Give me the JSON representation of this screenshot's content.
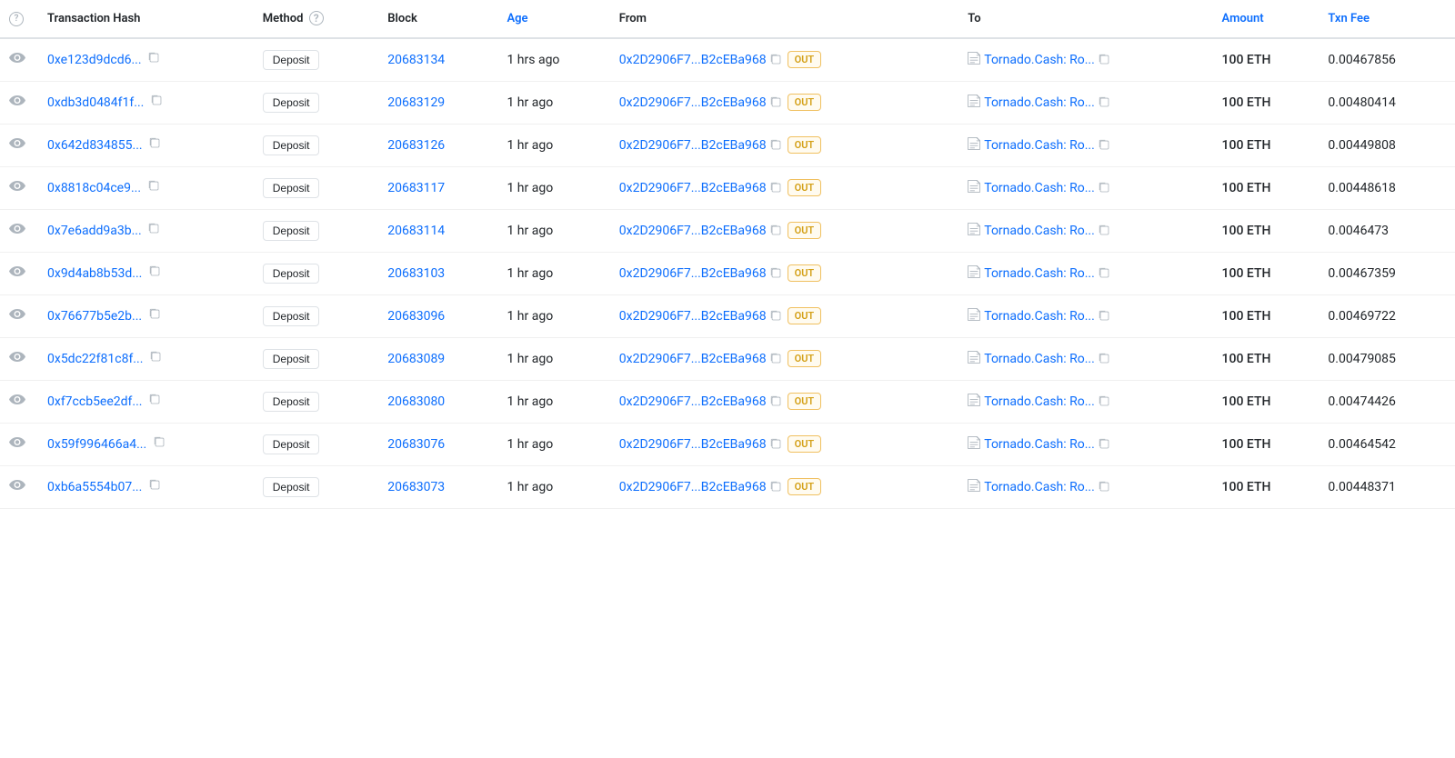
{
  "header": {
    "col_info": "ⓘ",
    "col_tx_hash": "Transaction Hash",
    "col_method": "Method",
    "col_method_help": "?",
    "col_block": "Block",
    "col_age": "Age",
    "col_from": "From",
    "col_to": "To",
    "col_amount": "Amount",
    "col_txn_fee": "Txn Fee"
  },
  "rows": [
    {
      "tx_hash": "0xe123d9dcd6...",
      "method": "Deposit",
      "block": "20683134",
      "age": "1 hrs ago",
      "from": "0x2D2906F7...B2cEBa968",
      "direction": "OUT",
      "to": "Tornado.Cash: Ro...",
      "amount": "100 ETH",
      "txn_fee": "0.00467856"
    },
    {
      "tx_hash": "0xdb3d0484f1f...",
      "method": "Deposit",
      "block": "20683129",
      "age": "1 hr ago",
      "from": "0x2D2906F7...B2cEBa968",
      "direction": "OUT",
      "to": "Tornado.Cash: Ro...",
      "amount": "100 ETH",
      "txn_fee": "0.00480414"
    },
    {
      "tx_hash": "0x642d834855...",
      "method": "Deposit",
      "block": "20683126",
      "age": "1 hr ago",
      "from": "0x2D2906F7...B2cEBa968",
      "direction": "OUT",
      "to": "Tornado.Cash: Ro...",
      "amount": "100 ETH",
      "txn_fee": "0.00449808"
    },
    {
      "tx_hash": "0x8818c04ce9...",
      "method": "Deposit",
      "block": "20683117",
      "age": "1 hr ago",
      "from": "0x2D2906F7...B2cEBa968",
      "direction": "OUT",
      "to": "Tornado.Cash: Ro...",
      "amount": "100 ETH",
      "txn_fee": "0.00448618"
    },
    {
      "tx_hash": "0x7e6add9a3b...",
      "method": "Deposit",
      "block": "20683114",
      "age": "1 hr ago",
      "from": "0x2D2906F7...B2cEBa968",
      "direction": "OUT",
      "to": "Tornado.Cash: Ro...",
      "amount": "100 ETH",
      "txn_fee": "0.0046473"
    },
    {
      "tx_hash": "0x9d4ab8b53d...",
      "method": "Deposit",
      "block": "20683103",
      "age": "1 hr ago",
      "from": "0x2D2906F7...B2cEBa968",
      "direction": "OUT",
      "to": "Tornado.Cash: Ro...",
      "amount": "100 ETH",
      "txn_fee": "0.00467359"
    },
    {
      "tx_hash": "0x76677b5e2b...",
      "method": "Deposit",
      "block": "20683096",
      "age": "1 hr ago",
      "from": "0x2D2906F7...B2cEBa968",
      "direction": "OUT",
      "to": "Tornado.Cash: Ro...",
      "amount": "100 ETH",
      "txn_fee": "0.00469722"
    },
    {
      "tx_hash": "0x5dc22f81c8f...",
      "method": "Deposit",
      "block": "20683089",
      "age": "1 hr ago",
      "from": "0x2D2906F7...B2cEBa968",
      "direction": "OUT",
      "to": "Tornado.Cash: Ro...",
      "amount": "100 ETH",
      "txn_fee": "0.00479085"
    },
    {
      "tx_hash": "0xf7ccb5ee2df...",
      "method": "Deposit",
      "block": "20683080",
      "age": "1 hr ago",
      "from": "0x2D2906F7...B2cEBa968",
      "direction": "OUT",
      "to": "Tornado.Cash: Ro...",
      "amount": "100 ETH",
      "txn_fee": "0.00474426"
    },
    {
      "tx_hash": "0x59f996466a4...",
      "method": "Deposit",
      "block": "20683076",
      "age": "1 hr ago",
      "from": "0x2D2906F7...B2cEBa968",
      "direction": "OUT",
      "to": "Tornado.Cash: Ro...",
      "amount": "100 ETH",
      "txn_fee": "0.00464542"
    },
    {
      "tx_hash": "0xb6a5554b07...",
      "method": "Deposit",
      "block": "20683073",
      "age": "1 hr ago",
      "from": "0x2D2906F7...B2cEBa968",
      "direction": "OUT",
      "to": "Tornado.Cash: Ro...",
      "amount": "100 ETH",
      "txn_fee": "0.00448371"
    }
  ]
}
